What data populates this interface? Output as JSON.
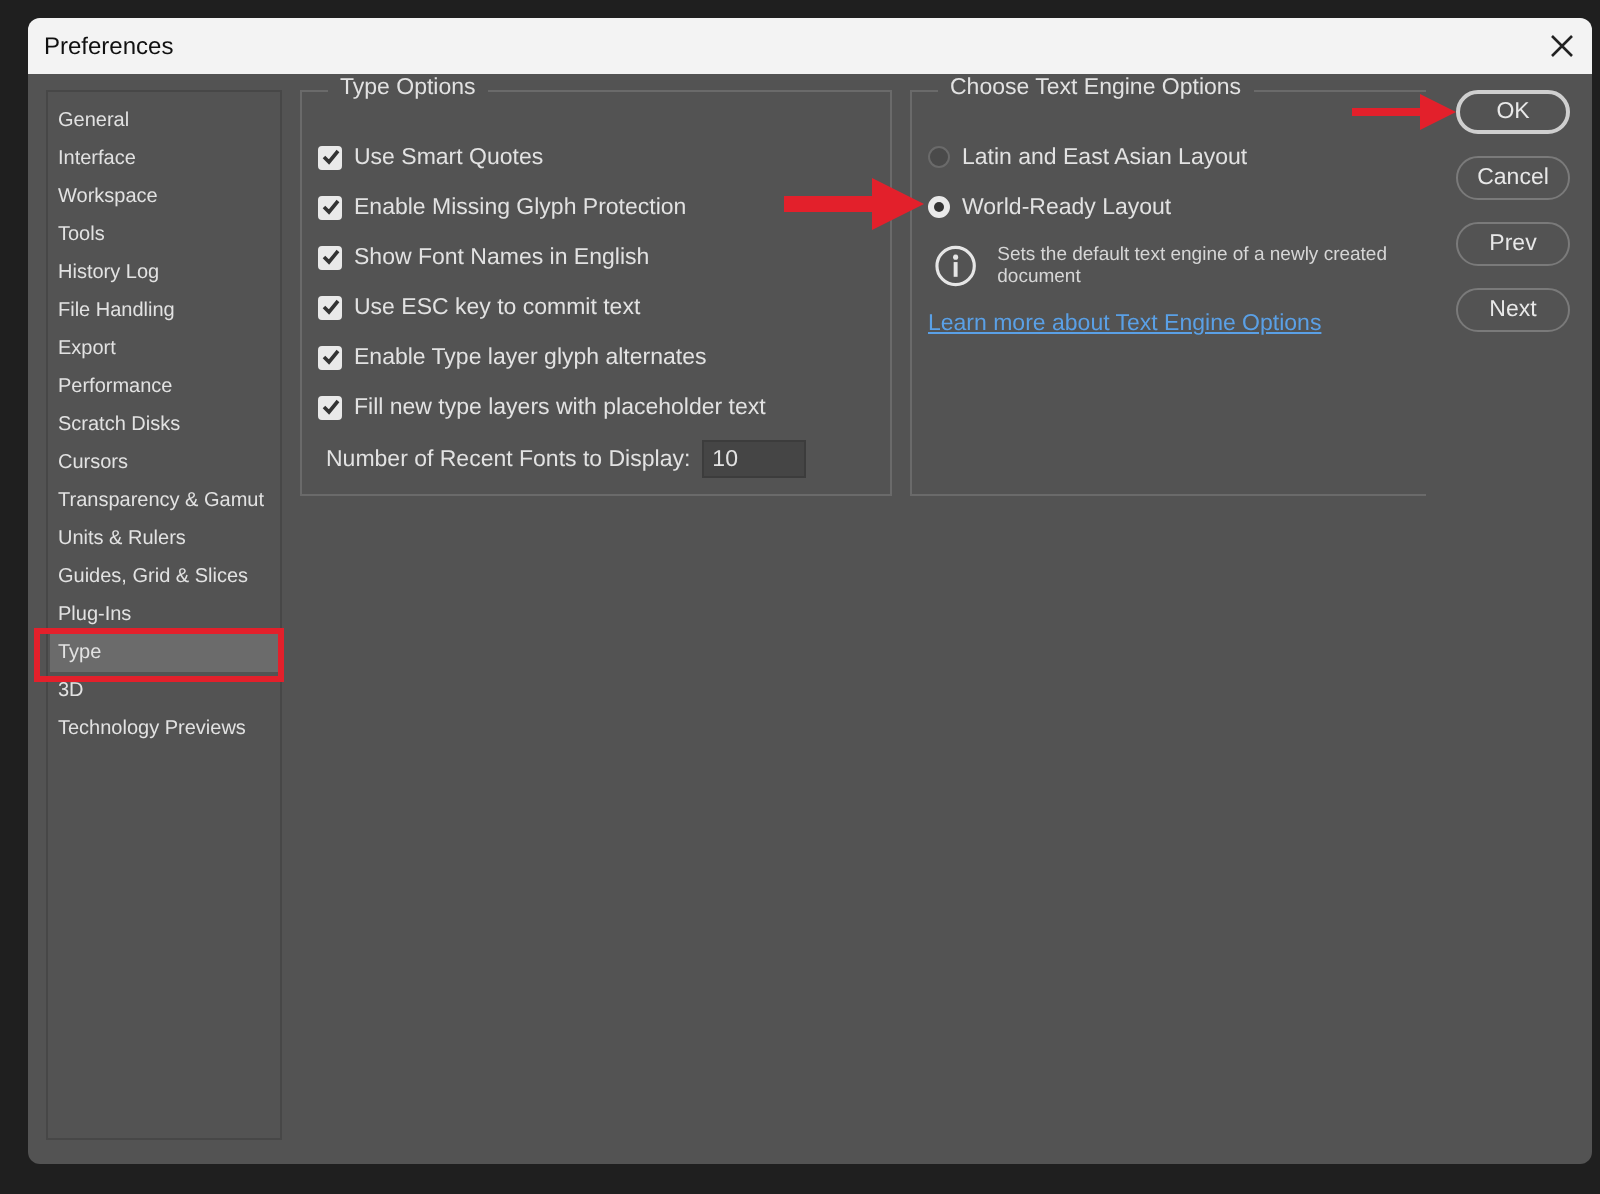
{
  "window": {
    "title": "Preferences"
  },
  "sidebar": {
    "items": [
      {
        "label": "General",
        "selected": false
      },
      {
        "label": "Interface",
        "selected": false
      },
      {
        "label": "Workspace",
        "selected": false
      },
      {
        "label": "Tools",
        "selected": false
      },
      {
        "label": "History Log",
        "selected": false
      },
      {
        "label": "File Handling",
        "selected": false
      },
      {
        "label": "Export",
        "selected": false
      },
      {
        "label": "Performance",
        "selected": false
      },
      {
        "label": "Scratch Disks",
        "selected": false
      },
      {
        "label": "Cursors",
        "selected": false
      },
      {
        "label": "Transparency & Gamut",
        "selected": false
      },
      {
        "label": "Units & Rulers",
        "selected": false
      },
      {
        "label": "Guides, Grid & Slices",
        "selected": false
      },
      {
        "label": "Plug-Ins",
        "selected": false
      },
      {
        "label": "Type",
        "selected": true
      },
      {
        "label": "3D",
        "selected": false
      },
      {
        "label": "Technology Previews",
        "selected": false
      }
    ]
  },
  "type_options": {
    "title": "Type Options",
    "checkboxes": [
      {
        "label": "Use Smart Quotes",
        "checked": true
      },
      {
        "label": "Enable Missing Glyph Protection",
        "checked": true
      },
      {
        "label": "Show Font Names in English",
        "checked": true
      },
      {
        "label": "Use ESC key to commit text",
        "checked": true
      },
      {
        "label": "Enable Type layer glyph alternates",
        "checked": true
      },
      {
        "label": "Fill new type layers with placeholder text",
        "checked": true
      }
    ],
    "recent_fonts": {
      "label": "Number of Recent Fonts to Display:",
      "value": "10"
    }
  },
  "text_engine": {
    "title": "Choose Text Engine Options",
    "options": [
      {
        "label": "Latin and East Asian Layout",
        "selected": false
      },
      {
        "label": "World-Ready Layout",
        "selected": true
      }
    ],
    "info": "Sets the default text engine of a newly created document",
    "link": "Learn more about Text Engine Options"
  },
  "buttons": [
    {
      "label": "OK",
      "default": true
    },
    {
      "label": "Cancel",
      "default": false
    },
    {
      "label": "Prev",
      "default": false
    },
    {
      "label": "Next",
      "default": false
    }
  ]
}
